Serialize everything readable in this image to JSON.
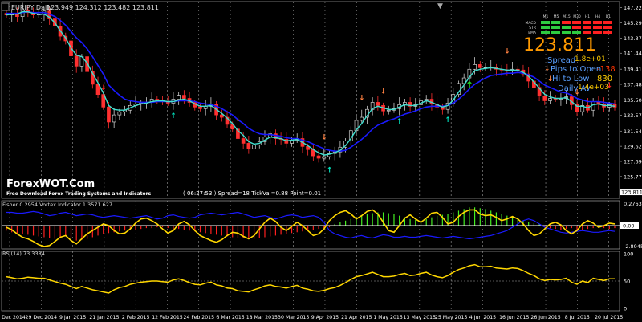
{
  "window": {
    "title": "EURJPY,Daily",
    "ohlc": "123.949 124.312 123.482 123.811",
    "symbol_box": "▼"
  },
  "watermark": {
    "brand": "ForexWOT.Com",
    "tagline": "Free Download Forex Trading Systems and Indicators"
  },
  "status_bar": {
    "text": "( 06:27:53 ) Spread=18  TickVal=0.88  Point=0.01"
  },
  "info_panel": {
    "price": "123.811",
    "spread_label": "Spread",
    "spread_value": "1.8e+01",
    "pips_label": "Pips to Open",
    "pips_value": "-138",
    "hilo_label": "Hi to Low",
    "hilo_value": "830",
    "daily_label": "Daily Av",
    "daily_value": "1.4e+03",
    "colors": {
      "price": "#ff9900",
      "pips": "#ff3300",
      "hilo": "#ffcc00",
      "label": "#5aa0ff"
    }
  },
  "signal_table": {
    "timeframes": [
      "M1",
      "M5",
      "M15",
      "M30",
      "H1",
      "H4",
      "D1"
    ],
    "rows": [
      {
        "name": "MACD",
        "cells": [
          "green",
          "green",
          "red",
          "red",
          "red",
          "red",
          "red"
        ]
      },
      {
        "name": "STR",
        "cells": [
          "green",
          "green",
          "green",
          "red",
          "red",
          "red",
          "red"
        ]
      },
      {
        "name": "EMA",
        "cells": [
          "green",
          "green",
          "green",
          "green",
          "red",
          "red",
          "red"
        ]
      }
    ]
  },
  "main_axis": {
    "ticks": [
      "147.220",
      "145.295",
      "143.370",
      "141.445",
      "139.410",
      "137.485",
      "135.500",
      "133.575",
      "131.545",
      "129.620",
      "127.695",
      "125.770"
    ],
    "last_price_tag": "123.811"
  },
  "fisher_panel": {
    "label": "Fisher 0.2954  Vortex Indicator 1.3571.627",
    "axis": [
      "0.2763",
      "0.00",
      "-2.8045"
    ],
    "level_tag": "0.00"
  },
  "rsi_panel": {
    "label": "RSI(14) 73.3384",
    "axis": [
      "100",
      "50",
      "0"
    ]
  },
  "date_axis": [
    "16 Dec 2014",
    "29 Dec 2014",
    "9 Jan 2015",
    "21 Jan 2015",
    "2 Feb 2015",
    "12 Feb 2015",
    "24 Feb 2015",
    "6 Mar 2015",
    "18 Mar 2015",
    "30 Mar 2015",
    "9 Apr 2015",
    "21 Apr 2015",
    "1 May 2015",
    "13 May 2015",
    "25 May 2015",
    "4 Jun 2015",
    "16 Jun 2015",
    "26 Jun 2015",
    "8 Jul 2015",
    "20 Jul 2015"
  ],
  "chart_data": {
    "type": "line",
    "title": "EURJPY,Daily",
    "price_series": [
      146.3,
      146.5,
      146.1,
      146.9,
      146.6,
      146.3,
      146.4,
      146.8,
      145.8,
      144.9,
      143.6,
      143.0,
      141.1,
      139.8,
      141.0,
      139.1,
      137.5,
      136.2,
      134.6,
      132.7,
      133.6,
      134.0,
      134.2,
      134.8,
      135.0,
      135.1,
      135.2,
      135.6,
      135.5,
      135.3,
      135.1,
      135.6,
      136.1,
      135.7,
      135.2,
      134.6,
      134.4,
      134.7,
      134.9,
      133.6,
      133.3,
      132.4,
      131.8,
      130.6,
      130.0,
      129.3,
      129.8,
      130.2,
      130.8,
      131.2,
      130.6,
      130.5,
      130.0,
      130.4,
      130.6,
      129.6,
      129.2,
      128.4,
      128.1,
      128.3,
      128.7,
      128.9,
      129.5,
      130.3,
      131.6,
      132.9,
      133.3,
      134.3,
      135.2,
      134.8,
      134.1,
      134.2,
      134.4,
      134.9,
      135.2,
      134.7,
      134.9,
      135.4,
      135.6,
      135.0,
      134.6,
      134.3,
      135.1,
      136.2,
      137.6,
      138.3,
      139.4,
      140.0,
      139.6,
      139.6,
      139.7,
      139.4,
      139.3,
      139.2,
      139.4,
      139.3,
      138.8,
      137.9,
      137.1,
      136.0,
      135.4,
      135.7,
      135.6,
      135.7,
      135.9,
      134.9,
      134.0,
      134.8,
      134.2,
      135.3,
      135.0,
      134.6,
      134.9,
      134.6
    ],
    "ema_fast": [
      146.3,
      146.4,
      146.4,
      146.7,
      146.7,
      146.5,
      146.4,
      146.4,
      146.0,
      145.3,
      144.3,
      143.4,
      142.1,
      141.2,
      141.0,
      140.2,
      138.9,
      137.7,
      136.4,
      134.8,
      134.3,
      134.2,
      134.2,
      134.5,
      134.8,
      135.0,
      135.1,
      135.3,
      135.4,
      135.4,
      135.3,
      135.3,
      135.5,
      135.6,
      135.4,
      135.0,
      134.7,
      134.7,
      134.8,
      134.3,
      133.8,
      133.2,
      132.5,
      131.6,
      131.0,
      130.2,
      129.9,
      130.0,
      130.4,
      130.8,
      130.7,
      130.6,
      130.3,
      130.4,
      130.5,
      130.1,
      129.7,
      129.2,
      128.8,
      128.5,
      128.6,
      128.8,
      129.1,
      129.7,
      130.6,
      131.7,
      132.5,
      133.5,
      134.4,
      134.7,
      134.5,
      134.3,
      134.3,
      134.6,
      134.9,
      134.8,
      134.8,
      135.1,
      135.4,
      135.2,
      134.9,
      134.6,
      134.8,
      135.5,
      136.5,
      137.4,
      138.4,
      139.2,
      139.4,
      139.5,
      139.6,
      139.5,
      139.4,
      139.3,
      139.3,
      139.3,
      139.0,
      138.5,
      137.8,
      137.0,
      136.2,
      135.9,
      135.7,
      135.7,
      135.8,
      135.3,
      134.7,
      134.7,
      134.5,
      134.9,
      135.0,
      134.8,
      134.8,
      134.7
    ],
    "ema_slow": [
      146.5,
      146.5,
      146.5,
      146.6,
      146.7,
      146.6,
      146.6,
      146.6,
      146.4,
      146.1,
      145.6,
      145.0,
      144.2,
      143.4,
      142.8,
      142.0,
      141.0,
      139.9,
      138.8,
      137.4,
      136.7,
      136.1,
      135.6,
      135.4,
      135.3,
      135.2,
      135.2,
      135.2,
      135.3,
      135.3,
      135.3,
      135.3,
      135.4,
      135.4,
      135.4,
      135.3,
      135.1,
      135.0,
      134.9,
      134.7,
      134.4,
      134.0,
      133.6,
      133.0,
      132.5,
      131.9,
      131.5,
      131.2,
      131.1,
      131.1,
      131.0,
      130.9,
      130.7,
      130.6,
      130.6,
      130.4,
      130.2,
      129.9,
      129.6,
      129.3,
      129.1,
      129.0,
      129.0,
      129.1,
      129.5,
      130.0,
      130.5,
      131.1,
      131.8,
      132.3,
      132.6,
      132.9,
      133.1,
      133.4,
      133.7,
      133.9,
      134.1,
      134.4,
      134.6,
      134.7,
      134.7,
      134.7,
      134.8,
      135.1,
      135.6,
      136.2,
      136.9,
      137.5,
      137.9,
      138.3,
      138.6,
      138.7,
      138.8,
      138.9,
      138.9,
      139.0,
      138.9,
      138.7,
      138.4,
      137.9,
      137.4,
      137.1,
      136.8,
      136.5,
      136.4,
      136.1,
      135.7,
      135.5,
      135.3,
      135.3,
      135.3,
      135.2,
      135.1,
      135.0
    ],
    "ylim": [
      123.0,
      148.0
    ],
    "x_categories": [
      "16 Dec 2014",
      "29 Dec 2014",
      "9 Jan 2015",
      "21 Jan 2015",
      "2 Feb 2015",
      "12 Feb 2015",
      "24 Feb 2015",
      "6 Mar 2015",
      "18 Mar 2015",
      "30 Mar 2015",
      "9 Apr 2015",
      "21 Apr 2015",
      "1 May 2015",
      "13 May 2015",
      "25 May 2015",
      "4 Jun 2015",
      "16 Jun 2015",
      "26 Jun 2015",
      "8 Jul 2015",
      "20 Jul 2015"
    ],
    "colors": {
      "ema_fast": "#40e0d0",
      "ema_slow": "#1a1aff",
      "bull": "#cccccc",
      "bear": "#ff3030"
    },
    "fisher_histogram": [
      -0.6,
      -0.8,
      -0.9,
      -1.0,
      -1.1,
      -1.2,
      -1.3,
      -1.4,
      -1.5,
      -1.6,
      -1.5,
      -1.3,
      -1.6,
      -1.8,
      -1.7,
      -1.6,
      -1.4,
      -1.2,
      -1.0,
      -0.9,
      -0.8,
      -0.7,
      -0.6,
      -0.5,
      -0.5,
      -0.4,
      -0.3,
      -0.3,
      -0.2,
      -0.2,
      -0.3,
      -0.4,
      -0.4,
      -0.5,
      -0.6,
      -0.7,
      -0.8,
      -0.9,
      -1.0,
      -1.1,
      -1.2,
      -1.3,
      -1.4,
      -1.5,
      -1.5,
      -1.6,
      -1.6,
      -1.5,
      -1.4,
      -1.3,
      -1.2,
      -1.1,
      -1.0,
      -0.9,
      -0.8,
      -0.7,
      -0.6,
      -0.5,
      -0.4,
      -0.3,
      -0.2,
      0.2,
      0.4,
      0.6,
      0.8,
      1.0,
      1.2,
      1.4,
      1.5,
      1.6,
      1.6,
      1.5,
      1.4,
      1.2,
      1.0,
      0.8,
      0.7,
      0.6,
      0.8,
      1.0,
      1.2,
      1.3,
      1.4,
      1.6,
      1.8,
      2.0,
      2.2,
      2.2,
      2.1,
      2.0,
      1.8,
      1.6,
      1.4,
      1.2,
      1.0,
      0.8,
      0.6,
      0.4,
      0.3,
      0.2,
      -0.2,
      -0.3,
      -0.4,
      -0.5,
      -0.4,
      -0.3,
      -0.5,
      -0.6,
      -0.4,
      -0.3,
      -0.2,
      -0.3,
      -0.4,
      -0.3
    ],
    "fisher_line": [
      -0.2,
      -0.5,
      -1.0,
      -1.4,
      -1.6,
      -1.9,
      -2.3,
      -2.5,
      -2.4,
      -1.9,
      -1.4,
      -1.2,
      -1.8,
      -2.2,
      -1.6,
      -1.0,
      -0.6,
      -0.2,
      0.2,
      0.0,
      -0.6,
      -1.0,
      -0.9,
      -0.4,
      0.3,
      0.8,
      0.9,
      0.6,
      0.2,
      -0.4,
      -0.9,
      -0.6,
      0.2,
      0.5,
      0.1,
      -0.6,
      -1.2,
      -1.5,
      -1.8,
      -2.0,
      -1.7,
      -1.2,
      -0.8,
      -0.9,
      -1.3,
      -1.6,
      -1.2,
      -0.4,
      0.4,
      0.9,
      0.5,
      -0.2,
      -0.6,
      -0.1,
      0.4,
      0.0,
      -0.6,
      -1.2,
      -1.0,
      -0.4,
      0.6,
      1.2,
      1.6,
      1.8,
      1.4,
      0.8,
      1.2,
      1.7,
      1.9,
      1.4,
      0.4,
      -0.6,
      -0.8,
      0.0,
      0.9,
      1.3,
      0.8,
      0.4,
      0.9,
      1.5,
      1.6,
      1.0,
      0.2,
      0.4,
      1.1,
      1.6,
      1.9,
      1.9,
      1.4,
      1.2,
      1.3,
      1.0,
      0.6,
      0.8,
      1.1,
      0.8,
      0.2,
      -0.6,
      -1.2,
      -1.0,
      -0.4,
      0.2,
      0.4,
      0.1,
      -0.6,
      -1.0,
      -0.6,
      0.2,
      0.6,
      0.3,
      -0.2,
      0.0,
      0.3,
      0.2
    ],
    "vortex_line": [
      1.6,
      1.6,
      1.5,
      1.5,
      1.6,
      1.7,
      1.6,
      1.4,
      1.2,
      1.3,
      1.5,
      1.6,
      1.4,
      1.2,
      1.3,
      1.4,
      1.3,
      1.1,
      1.0,
      1.1,
      1.2,
      1.1,
      1.0,
      0.9,
      1.0,
      1.1,
      1.2,
      1.0,
      0.8,
      0.9,
      1.2,
      1.3,
      1.1,
      1.0,
      0.9,
      1.0,
      1.3,
      1.4,
      1.5,
      1.4,
      1.3,
      1.4,
      1.5,
      1.6,
      1.4,
      1.2,
      1.0,
      1.1,
      1.2,
      1.0,
      0.8,
      1.0,
      1.2,
      1.3,
      1.2,
      1.0,
      1.1,
      1.2,
      1.0,
      0.4,
      -0.6,
      -1.0,
      -1.2,
      -1.4,
      -1.5,
      -1.3,
      -1.2,
      -1.4,
      -1.5,
      -1.3,
      -1.1,
      -1.2,
      -1.4,
      -1.4,
      -1.3,
      -1.4,
      -1.4,
      -1.3,
      -1.2,
      -1.3,
      -1.4,
      -1.5,
      -1.4,
      -1.3,
      -1.4,
      -1.5,
      -1.6,
      -1.5,
      -1.4,
      -1.3,
      -1.2,
      -1.0,
      -0.8,
      -0.6,
      -0.2,
      0.2,
      0.6,
      0.8,
      0.6,
      0.2,
      -0.2,
      -0.4,
      -0.6,
      -0.8,
      -0.9,
      -0.8,
      -0.7,
      -0.6,
      -0.7,
      -0.8,
      -0.8,
      -0.7,
      -0.6,
      -0.7
    ],
    "fisher_ylim": [
      -2.8045,
      3.0
    ],
    "rsi": [
      58,
      56,
      54,
      55,
      57,
      56,
      55,
      55,
      52,
      49,
      46,
      44,
      40,
      36,
      40,
      37,
      34,
      32,
      30,
      28,
      34,
      38,
      40,
      44,
      46,
      48,
      49,
      50,
      50,
      49,
      48,
      52,
      54,
      51,
      47,
      44,
      43,
      46,
      48,
      43,
      41,
      37,
      36,
      32,
      31,
      30,
      34,
      37,
      41,
      43,
      40,
      39,
      37,
      40,
      42,
      37,
      35,
      32,
      31,
      33,
      36,
      38,
      42,
      47,
      53,
      58,
      60,
      63,
      66,
      62,
      58,
      58,
      59,
      62,
      64,
      60,
      61,
      64,
      66,
      61,
      58,
      56,
      60,
      66,
      71,
      74,
      78,
      80,
      76,
      76,
      77,
      74,
      73,
      72,
      74,
      73,
      69,
      64,
      60,
      54,
      51,
      53,
      52,
      53,
      55,
      48,
      44,
      50,
      47,
      55,
      53,
      51,
      54,
      54
    ],
    "rsi_ylim": [
      0,
      100
    ],
    "rsi_levels": [
      50
    ],
    "up_arrows": [
      3,
      4,
      5,
      8,
      10,
      12,
      14,
      16,
      18,
      20,
      22,
      24,
      26,
      28,
      30,
      32,
      34,
      36,
      38,
      40,
      42,
      44,
      46,
      48,
      50
    ],
    "arrow_marks": [
      {
        "index": 18,
        "dir": "down",
        "color": "#ff2020"
      },
      {
        "index": 31,
        "dir": "up",
        "color": "#00e5c0"
      },
      {
        "index": 43,
        "dir": "down",
        "color": "#ff8040"
      },
      {
        "index": 60,
        "dir": "up",
        "color": "#00e5c0"
      },
      {
        "index": 59,
        "dir": "down",
        "color": "#ff8040"
      },
      {
        "index": 66,
        "dir": "down",
        "color": "#ff8040"
      },
      {
        "index": 70,
        "dir": "down",
        "color": "#ff8040"
      },
      {
        "index": 73,
        "dir": "up",
        "color": "#00e5c0"
      },
      {
        "index": 82,
        "dir": "up",
        "color": "#00e5c0"
      },
      {
        "index": 86,
        "dir": "up",
        "color": "#22dd22"
      },
      {
        "index": 93,
        "dir": "down",
        "color": "#ff8040"
      },
      {
        "index": 101,
        "dir": "down",
        "color": "#ff8040"
      },
      {
        "index": 106,
        "dir": "down",
        "color": "#ff8040"
      },
      {
        "index": 112,
        "dir": "down",
        "color": "#ff2020"
      }
    ]
  }
}
